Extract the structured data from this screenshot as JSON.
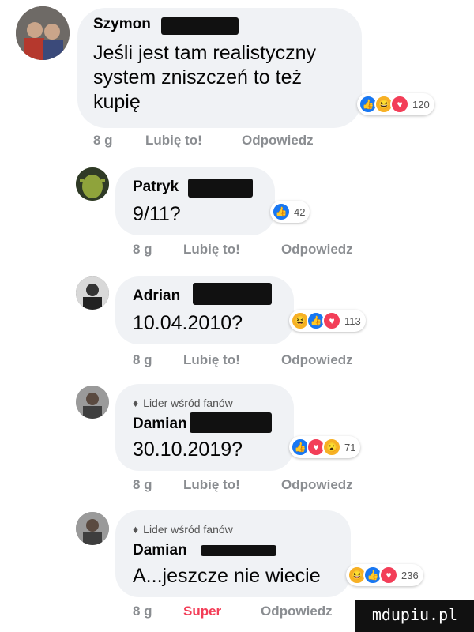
{
  "comments": [
    {
      "name": "Szymon",
      "fan_label": "",
      "text_lines": [
        "Jeśli jest tam realistyczny",
        "system zniszczeń to też",
        "kupię"
      ],
      "reactions": [
        "like-icon",
        "haha-icon",
        "love-icon"
      ],
      "count": "120",
      "time": "8 g",
      "like_label": "Lubię to!",
      "reply_label": "Odpowiedz"
    },
    {
      "name": "Patryk",
      "fan_label": "",
      "text_lines": [
        "9/11?"
      ],
      "reactions": [
        "like-icon"
      ],
      "count": "42",
      "time": "8 g",
      "like_label": "Lubię to!",
      "reply_label": "Odpowiedz"
    },
    {
      "name": "Adrian",
      "fan_label": "",
      "text_lines": [
        "10.04.2010?"
      ],
      "reactions": [
        "haha-icon",
        "like-icon",
        "love-icon"
      ],
      "count": "113",
      "time": "8 g",
      "like_label": "Lubię to!",
      "reply_label": "Odpowiedz"
    },
    {
      "name": "Damian",
      "fan_label": "Lider wśród fanów",
      "text_lines": [
        "30.10.2019?"
      ],
      "reactions": [
        "like-icon",
        "love-icon",
        "wow-icon"
      ],
      "count": "71",
      "time": "8 g",
      "like_label": "Lubię to!",
      "reply_label": "Odpowiedz"
    },
    {
      "name": "Damian",
      "fan_label": "Lider wśród fanów",
      "text_lines": [
        "A...jeszcze nie wiecie"
      ],
      "reactions": [
        "haha-icon",
        "like-icon",
        "love-icon"
      ],
      "count": "236",
      "time": "8 g",
      "like_label": "Super",
      "reply_label": "Odpowiedz"
    }
  ],
  "colors": {
    "like": "#1877f2",
    "love": "#f33e58",
    "haha": "#f7b125",
    "super_text": "#f33e58"
  },
  "watermark": "mdupiu.pl"
}
